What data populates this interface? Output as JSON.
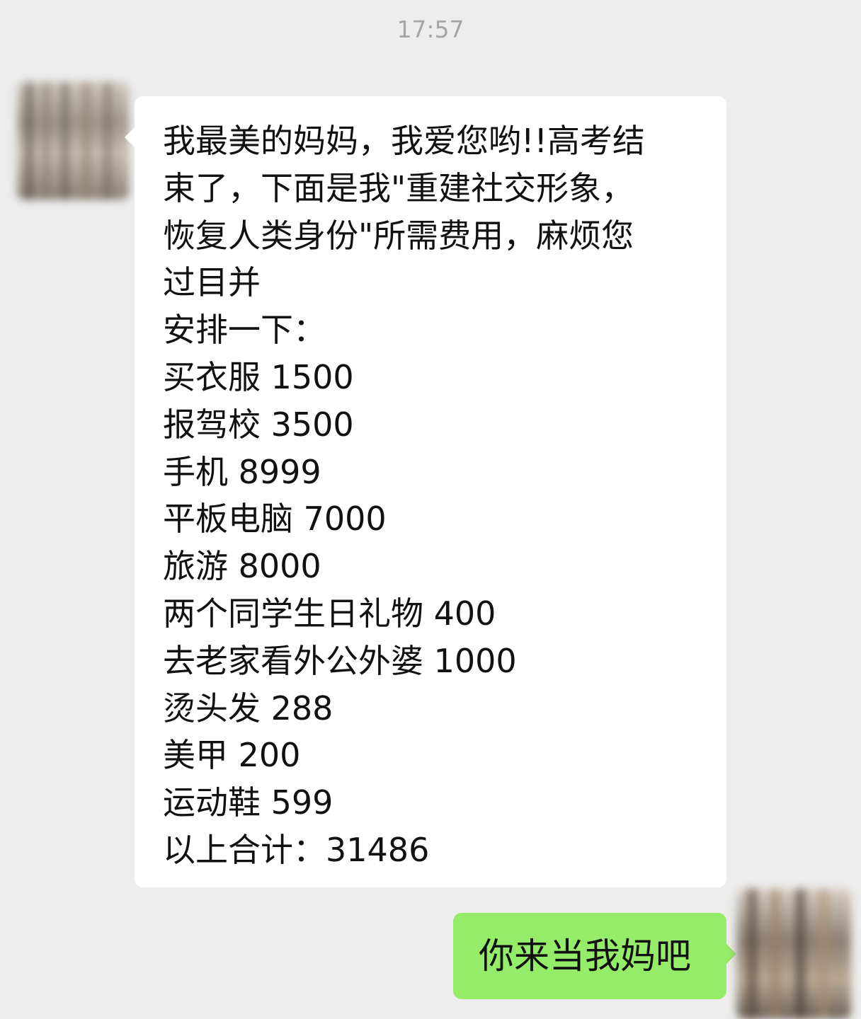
{
  "chat": {
    "timestamp": "17:57",
    "incoming_message": {
      "sender_avatar": "blurred-avatar",
      "lines": [
        "我最美的妈妈，我爱您哟!!高考结",
        "束了，下面是我\"重建社交形象，",
        "恢复人类身份\"所需费用，麻烦您",
        "过目并",
        "安排一下：",
        "买衣服 1500",
        "报驾校 3500",
        "手机 8999",
        "平板电脑 7000",
        "旅游 8000",
        "两个同学生日礼物 400",
        "去老家看外公外婆 1000",
        "烫头发 288",
        "美甲 200",
        "运动鞋 599",
        "以上合计：31486"
      ]
    },
    "outgoing_message": {
      "sender_avatar": "blurred-avatar",
      "text": "你来当我妈吧"
    }
  },
  "colors": {
    "background": "#ededed",
    "incoming_bubble": "#ffffff",
    "outgoing_bubble": "#95ec69",
    "timestamp_text": "#a6a6a6"
  }
}
